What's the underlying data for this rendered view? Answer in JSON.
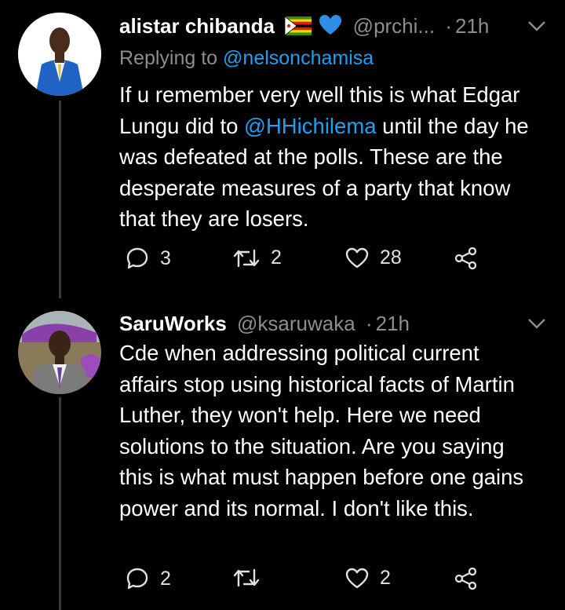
{
  "tweets": [
    {
      "display_name": "alistar chibanda",
      "handle": "@prchi...",
      "time": "21h",
      "replying_prefix": "Replying to ",
      "replying_to": "@nelsonchamisa",
      "body_pre": "If u remember very well this is what Edgar Lungu did to ",
      "body_mention": "@HHichilema",
      "body_post": " until the day he was defeated at the polls. These are the desperate measures of a party that know that they are losers.",
      "reply_count": "3",
      "retweet_count": "2",
      "like_count": "28"
    },
    {
      "display_name": "SaruWorks",
      "handle": "@ksaruwaka",
      "time": "21h",
      "body": "Cde when addressing political current affairs stop using historical facts of Martin Luther, they won't help. Here we need solutions to the situation. Are you saying this is what must happen before one gains power and its normal. I don't like this.",
      "reply_count": "2",
      "retweet_count": "",
      "like_count": "2"
    }
  ],
  "separator": "·",
  "colors": {
    "background": "#000000",
    "text": "#ffffff",
    "secondary": "#8a8d91",
    "link": "#1da1f2",
    "thread_line": "#3a3a3a"
  }
}
